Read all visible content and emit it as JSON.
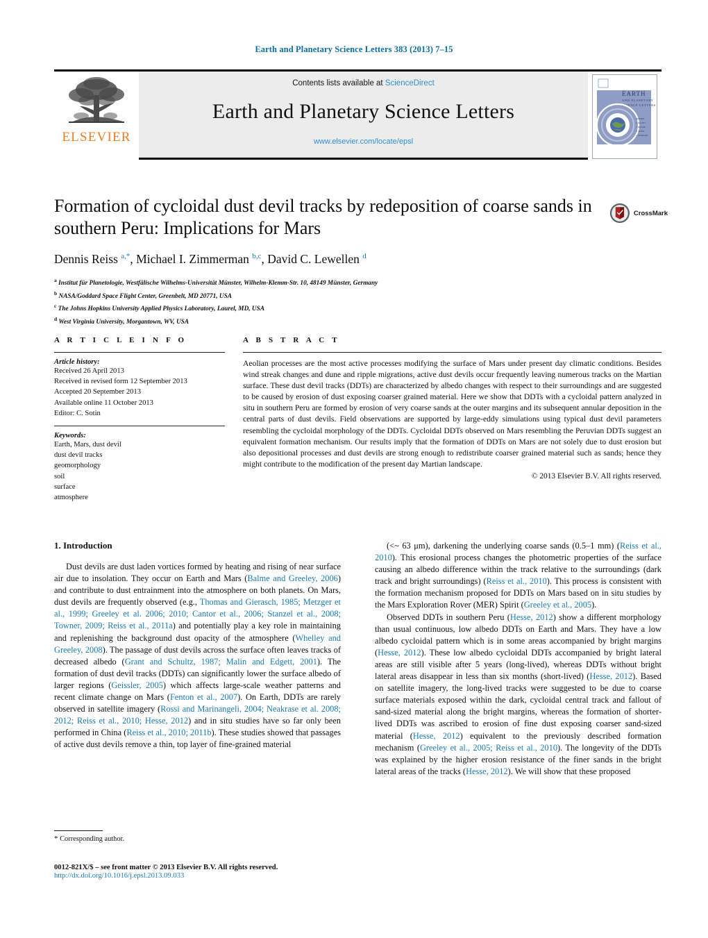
{
  "running_head": "Earth and Planetary Science Letters 383 (2013) 7–15",
  "masthead": {
    "contents_prefix": "Contents lists available at ",
    "sciencedirect": "ScienceDirect",
    "journal_name": "Earth and Planetary Science Letters",
    "journal_url": "www.elsevier.com/locate/epsl",
    "publisher_wordmark": "ELSEVIER",
    "cover_title_line1": "EARTH",
    "cover_title_line2": "AND PLANETARY",
    "cover_title_line3": "SCIENCE LETTERS"
  },
  "article": {
    "title": "Formation of cycloidal dust devil tracks by redeposition of coarse sands in southern Peru: Implications for Mars",
    "authors_html": "Dennis Reiss <sup>a,*</sup>, Michael I. Zimmerman <sup>b,c</sup>, David C. Lewellen <sup>d</sup>",
    "affiliations": [
      {
        "marker": "a",
        "text": "Institut für Planetologie, Westfälische Wilhelms-Universität Münster, Wilhelm-Klemm-Str. 10, 48149 Münster, Germany"
      },
      {
        "marker": "b",
        "text": "NASA/Goddard Space Flight Center, Greenbelt, MD 20771, USA"
      },
      {
        "marker": "c",
        "text": "The Johns Hopkins University Applied Physics Laboratory, Laurel, MD, USA"
      },
      {
        "marker": "d",
        "text": "West Virginia University, Morgantown, WV, USA"
      }
    ],
    "crossmark_label": "CrossMark"
  },
  "article_info": {
    "heading": "A R T I C L E    I N F O",
    "history_label": "Article history:",
    "history": [
      "Received 26 April 2013",
      "Received in revised form 12 September 2013",
      "Accepted 20 September 2013",
      "Available online 11 October 2013",
      "Editor: C. Sotin"
    ],
    "keywords_label": "Keywords:",
    "keywords": [
      "Earth, Mars, dust devil",
      "dust devil tracks",
      "geomorphology",
      "soil",
      "surface",
      "atmosphere"
    ]
  },
  "abstract": {
    "heading": "A B S T R A C T",
    "text": "Aeolian processes are the most active processes modifying the surface of Mars under present day climatic conditions. Besides wind streak changes and dune and ripple migrations, active dust devils occur frequently leaving numerous tracks on the Martian surface. These dust devil tracks (DDTs) are characterized by albedo changes with respect to their surroundings and are suggested to be caused by erosion of dust exposing coarser grained material. Here we show that DDTs with a cycloidal pattern analyzed in situ in southern Peru are formed by erosion of very coarse sands at the outer margins and its subsequent annular deposition in the central parts of dust devils. Field observations are supported by large-eddy simulations using typical dust devil parameters resembling the cycloidal morphology of the DDTs. Cycloidal DDTs observed on Mars resembling the Peruvian DDTs suggest an equivalent formation mechanism. Our results imply that the formation of DDTs on Mars are not solely due to dust erosion but also depositional processes and dust devils are strong enough to redistribute coarser grained material such as sands; hence they might contribute to the modification of the present day Martian landscape.",
    "copyright": "© 2013 Elsevier B.V. All rights reserved."
  },
  "body": {
    "section_number_title": "1. Introduction",
    "left_paragraph_1_html": "Dust devils are dust laden vortices formed by heating and rising of near surface air due to insolation. They occur on Earth and Mars (<span class=\"cit\">Balme and Greeley, 2006</span>) and contribute to dust entrainment into the atmosphere on both planets. On Mars, dust devils are frequently observed (e.g., <span class=\"cit\">Thomas and Gierasch, 1985; Metzger et al., 1999; Greeley et al. 2006; 2010; Cantor et al., 2006; Stanzel et al., 2008; Towner, 2009; Reiss et al., 2011a</span>) and potentially play a key role in maintaining and replenishing the background dust opacity of the atmosphere (<span class=\"cit\">Whelley and Greeley, 2008</span>). The passage of dust devils across the surface often leaves tracks of decreased albedo (<span class=\"cit\">Grant and Schultz, 1987; Malin and Edgett, 2001</span>). The formation of dust devil tracks (DDTs) can significantly lower the surface albedo of larger regions (<span class=\"cit\">Geissler, 2005</span>) which affects large-scale weather patterns and recent climate change on Mars (<span class=\"cit\">Fenton et al., 2007</span>). On Earth, DDTs are rarely observed in satellite imagery (<span class=\"cit\">Rossi and Marinangeli, 2004; Neakrase et al. 2008; 2012; Reiss et al., 2010; Hesse, 2012</span>) and in situ studies have so far only been performed in China (<span class=\"cit\">Reiss et al., 2010; 2011b</span>). These studies showed that passages of active dust devils remove a thin, top layer of fine-grained material",
    "right_paragraph_1_html": "(&lt;~ 63 μm), darkening the underlying coarse sands (0.5–1 mm) (<span class=\"cit\">Reiss et al., 2010</span>). This erosional process changes the photometric properties of the surface causing an albedo difference within the track relative to the surroundings (dark track and bright surroundings) (<span class=\"cit\">Reiss et al., 2010</span>). This process is consistent with the formation mechanism proposed for DDTs on Mars based on in situ studies by the Mars Exploration Rover (MER) Spirit (<span class=\"cit\">Greeley et al., 2005</span>).",
    "right_paragraph_2_html": "Observed DDTs in southern Peru (<span class=\"cit\">Hesse, 2012</span>) show a different morphology than usual continuous, low albedo DDTs on Earth and Mars. They have a low albedo cycloidal pattern which is in some areas accompanied by bright margins (<span class=\"cit\">Hesse, 2012</span>). These low albedo cycloidal DDTs accompanied by bright lateral areas are still visible after 5 years (long-lived), whereas DDTs without bright lateral areas disappear in less than six months (short-lived) (<span class=\"cit\">Hesse, 2012</span>). Based on satellite imagery, the long-lived tracks were suggested to be due to coarse surface materials exposed within the dark, cycloidal central track and fallout of sand-sized material along the bright margins, whereas the formation of shorter-lived DDTs was ascribed to erosion of fine dust exposing coarser sand-sized material (<span class=\"cit\">Hesse, 2012</span>) equivalent to the previously described formation mechanism (<span class=\"cit\">Greeley et al., 2005; Reiss et al., 2010</span>). The longevity of the DDTs was explained by the higher erosion resistance of the finer sands in the bright lateral areas of the tracks (<span class=\"cit\">Hesse, 2012</span>). We will show that these proposed"
  },
  "footnote": {
    "marker": "*",
    "text": "Corresponding author."
  },
  "footer": {
    "issn_line": "0012-821X/$ – see front matter  © 2013 Elsevier B.V. All rights reserved.",
    "doi": "http://dx.doi.org/10.1016/j.epsl.2013.09.033"
  },
  "colors": {
    "link_blue": "#1a7ab5",
    "header_blue": "#0b6ea8",
    "elsevier_orange": "#f07c22",
    "masthead_gray": "#ececec",
    "sd_blue": "#2f8fcf"
  }
}
